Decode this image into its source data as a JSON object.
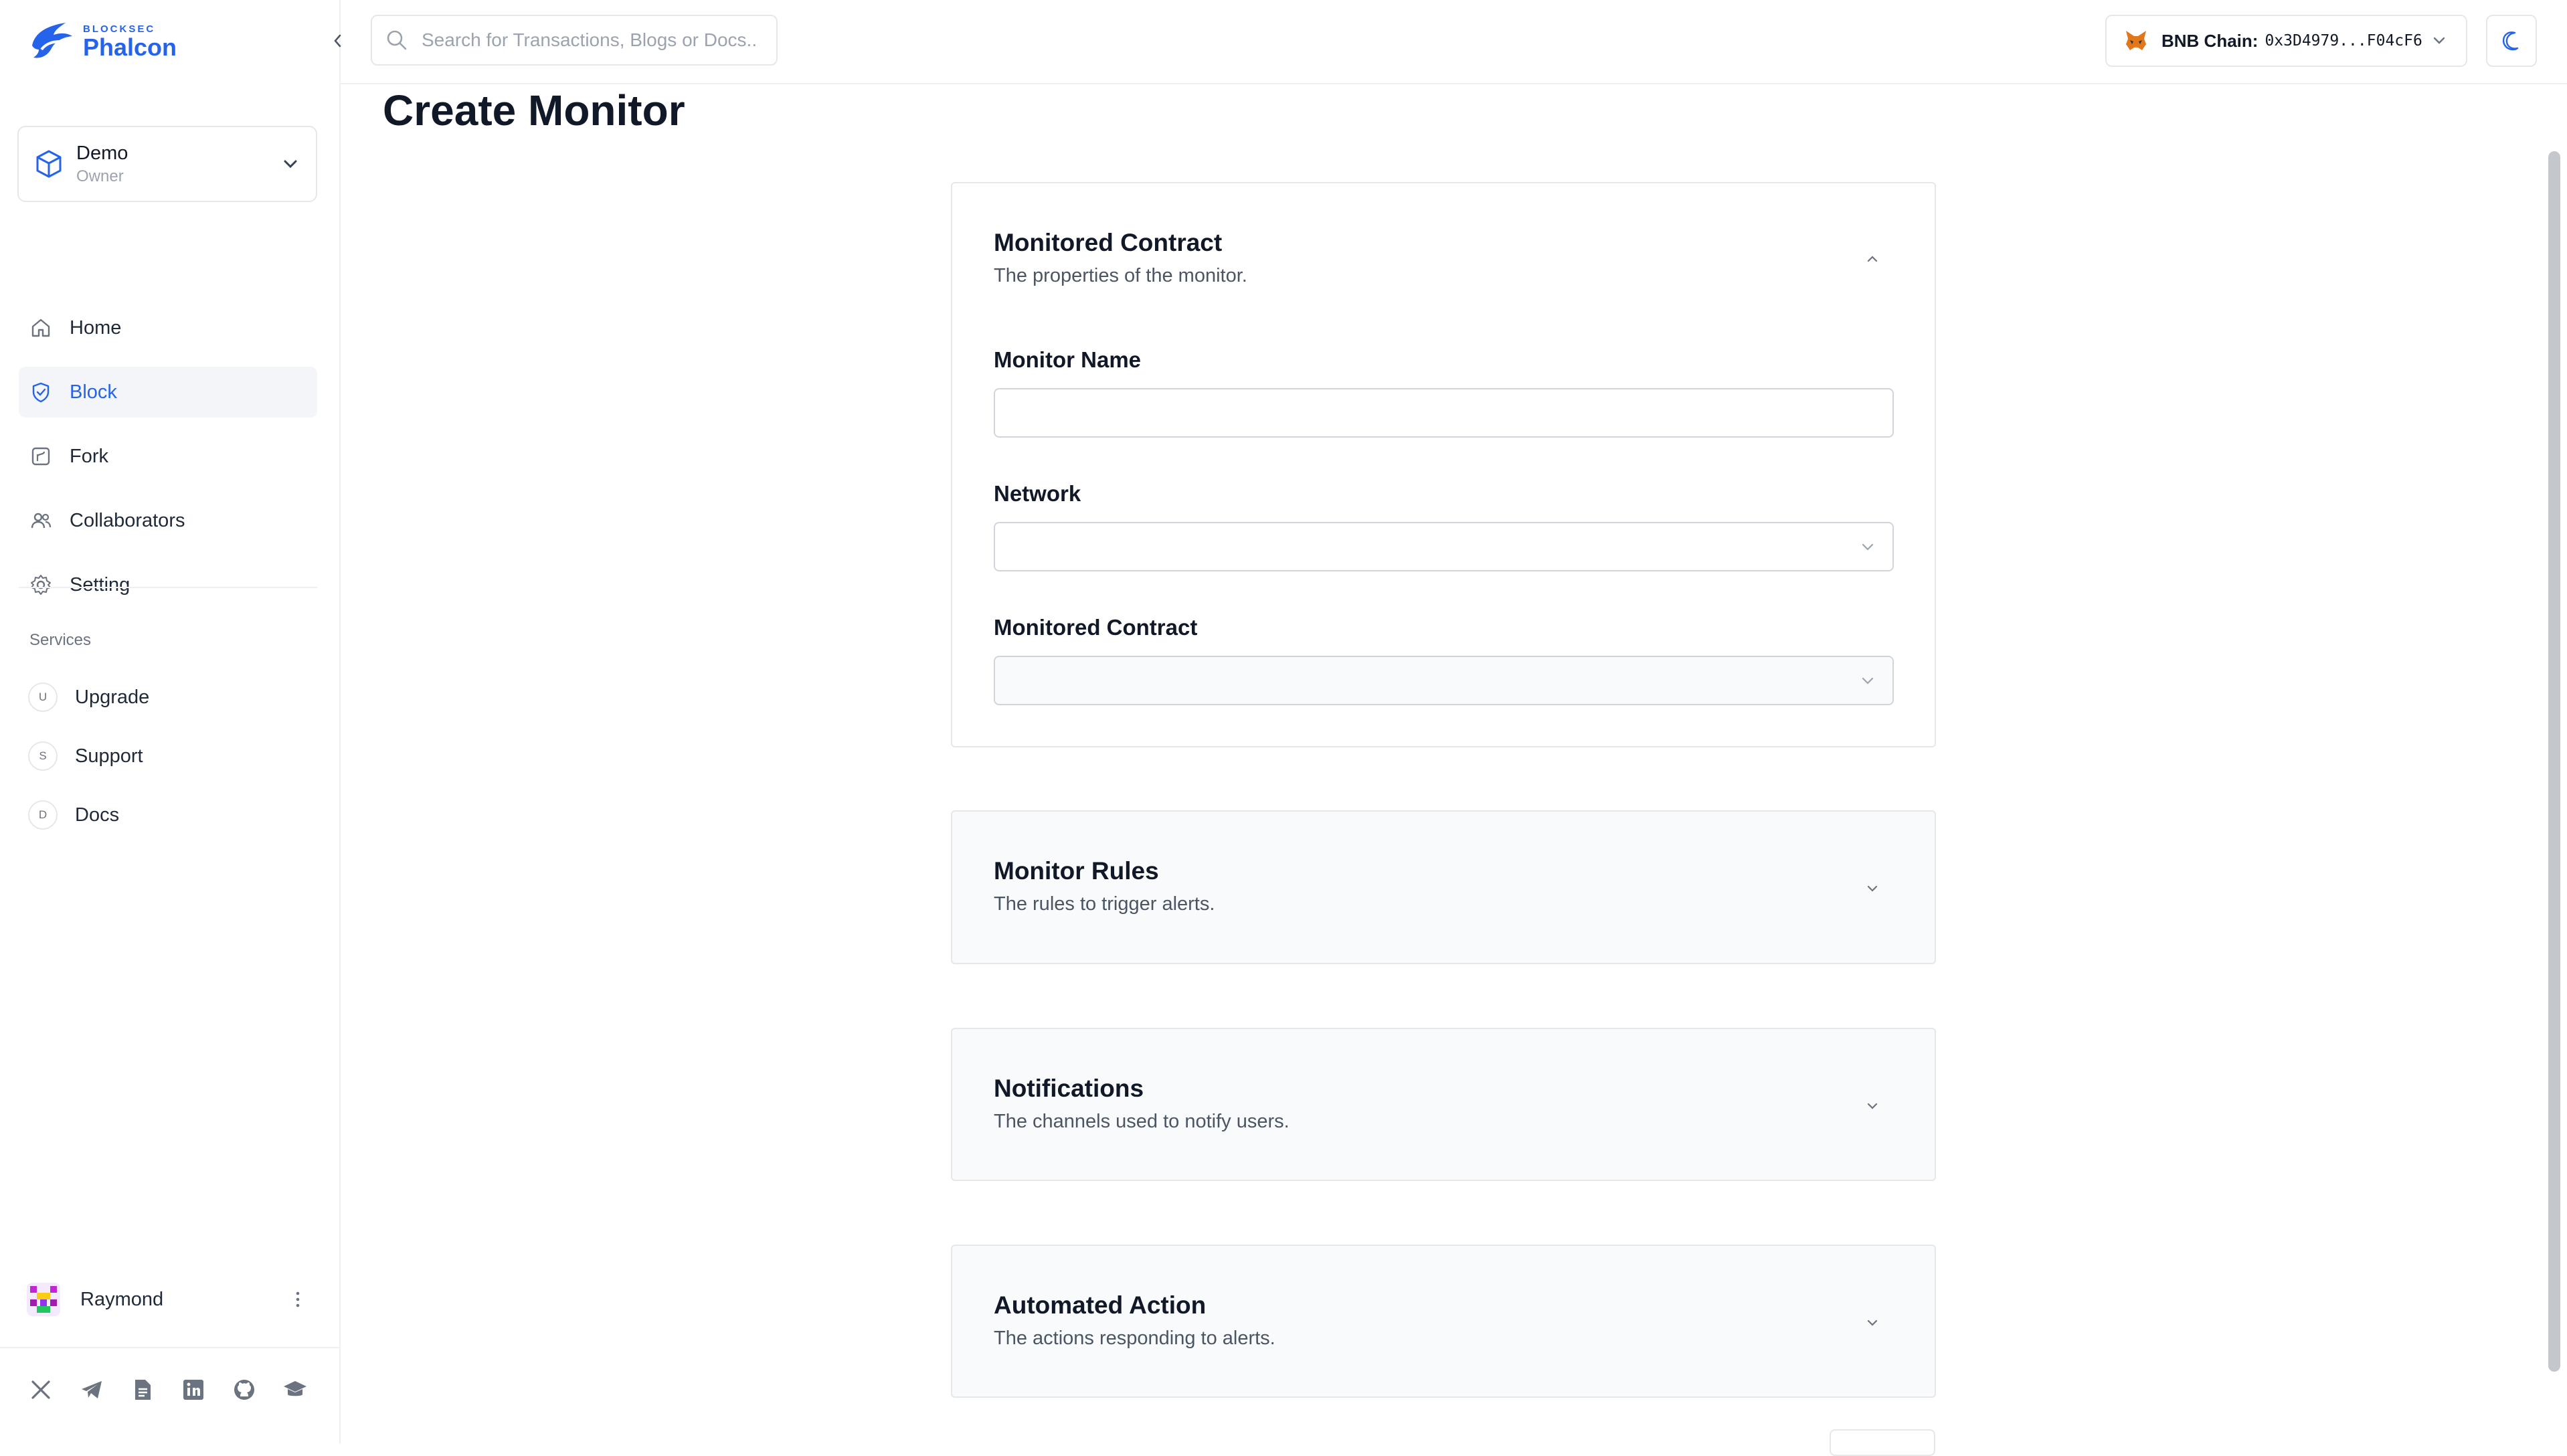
{
  "brand": {
    "sub": "BLOCKSEC",
    "name": "Phalcon",
    "color": "#2563eb"
  },
  "workspace": {
    "name": "Demo",
    "role": "Owner"
  },
  "nav": [
    {
      "label": "Home",
      "icon": "home-icon"
    },
    {
      "label": "Block",
      "icon": "shield-check-icon",
      "active": true
    },
    {
      "label": "Fork",
      "icon": "fork-icon"
    },
    {
      "label": "Collaborators",
      "icon": "users-icon"
    },
    {
      "label": "Setting",
      "icon": "gear-icon"
    }
  ],
  "services": {
    "title": "Services",
    "items": [
      {
        "badge": "U",
        "label": "Upgrade"
      },
      {
        "badge": "S",
        "label": "Support"
      },
      {
        "badge": "D",
        "label": "Docs"
      }
    ]
  },
  "user": {
    "name": "Raymond"
  },
  "socials": [
    "x-icon",
    "telegram-icon",
    "document-icon",
    "linkedin-icon",
    "github-icon",
    "academy-icon"
  ],
  "search": {
    "placeholder": "Search for Transactions, Blogs or Docs...",
    "value": ""
  },
  "wallet": {
    "chain_label": "BNB Chain:",
    "address": "0x3D4979...F04cF6"
  },
  "page": {
    "title": "Create Monitor"
  },
  "sections": {
    "contract": {
      "title": "Monitored Contract",
      "subtitle": "The properties of the monitor.",
      "expanded": true,
      "fields": {
        "monitor_name": {
          "label": "Monitor Name",
          "value": ""
        },
        "network": {
          "label": "Network",
          "value": ""
        },
        "monitored_contract": {
          "label": "Monitored Contract",
          "value": ""
        }
      }
    },
    "rules": {
      "title": "Monitor Rules",
      "subtitle": "The rules to trigger alerts."
    },
    "notifications": {
      "title": "Notifications",
      "subtitle": "The channels used to notify users."
    },
    "action": {
      "title": "Automated Action",
      "subtitle": "The actions responding to alerts."
    }
  },
  "colors": {
    "accent": "#2563eb",
    "border": "#e5e7eb",
    "muted": "#9ca3af",
    "active_bg": "#f3f5f8"
  }
}
